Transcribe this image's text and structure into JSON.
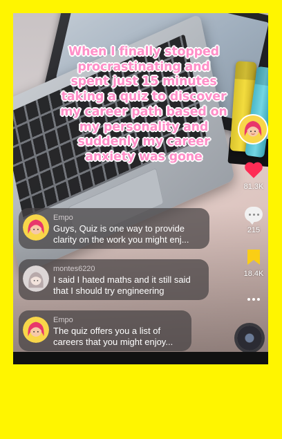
{
  "caption": {
    "line1": "When I finally stopped",
    "line2": "procrastinating and",
    "line3": "spent just 15 minutes",
    "line4": "taking a quiz to discover",
    "line5": "my career path based on",
    "line6": "my personality and",
    "line7": "suddenly my career",
    "line8": "anxiety was gone"
  },
  "rail": {
    "likes": "81.3K",
    "comments": "215",
    "saves": "18.4K",
    "icons": [
      "profile-avatar",
      "heart-icon",
      "comment-icon",
      "bookmark-icon",
      "more-icon",
      "music-disc-icon"
    ]
  },
  "comments": [
    {
      "user": "Empo",
      "text": "Guys, Quiz is one way to provide clarity on the work you might enj..."
    },
    {
      "user": "montes6220",
      "text": "I said I hated maths and it still said that I should try engineering"
    },
    {
      "user": "Empo",
      "text": "The quiz offers you a list of careers that you might enjoy..."
    }
  ],
  "colors": {
    "page_background": "#FFF500",
    "caption_pink": "#FF8FC8",
    "heart_red": "#FE2C55",
    "bookmark_yellow": "#FACE15"
  }
}
